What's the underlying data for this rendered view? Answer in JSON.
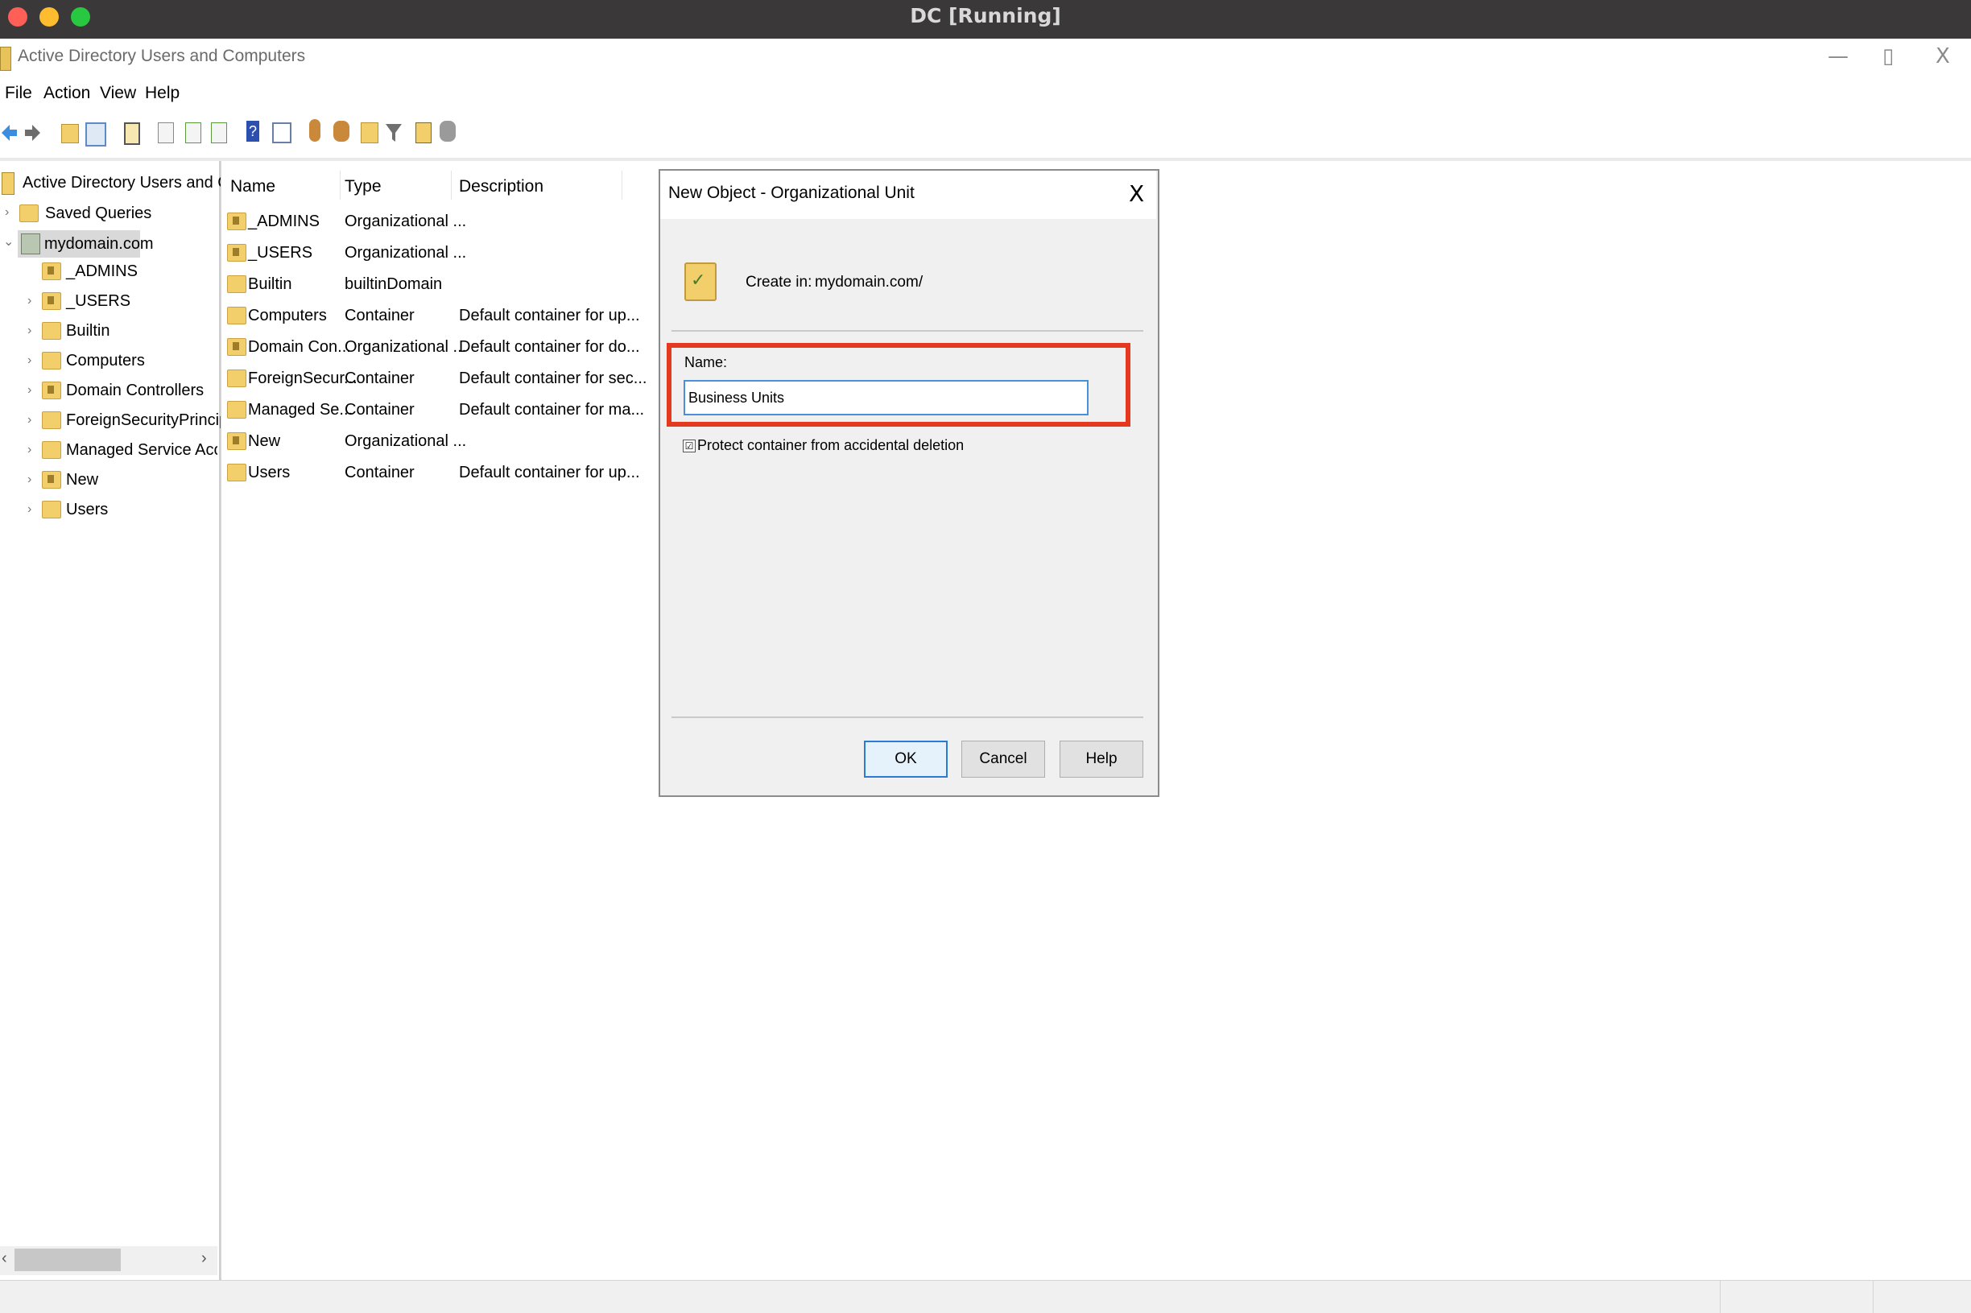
{
  "mac": {
    "title": "DC [Running]",
    "colors": {
      "close": "#fe5f57",
      "minimize": "#febc2e",
      "zoom": "#28c840"
    }
  },
  "window": {
    "title": "Active Directory Users and Computers",
    "minimize": "—",
    "restore": "▯",
    "close": "X"
  },
  "menu": {
    "items": [
      "File",
      "Action",
      "View",
      "Help"
    ]
  },
  "toolbar": {
    "icons": [
      "back-icon",
      "forward-icon",
      "up-folder-icon",
      "show-hide-console-tree-icon",
      "clipboard-icon",
      "properties-icon",
      "refresh-icon",
      "export-list-icon",
      "help-icon",
      "console-view-icon",
      "new-user-icon",
      "new-group-icon",
      "new-ou-icon",
      "filter-icon",
      "find-icon",
      "delegate-control-icon"
    ]
  },
  "tree": {
    "root": "Active Directory Users and Comp",
    "saved_queries": "Saved Queries",
    "domain": "mydomain.com",
    "children": [
      {
        "label": "_ADMINS",
        "chevron": ""
      },
      {
        "label": "_USERS",
        "chevron": "›"
      },
      {
        "label": "Builtin",
        "chevron": "›"
      },
      {
        "label": "Computers",
        "chevron": "›"
      },
      {
        "label": "Domain Controllers",
        "chevron": "›"
      },
      {
        "label": "ForeignSecurityPrincipals",
        "chevron": "›"
      },
      {
        "label": "Managed Service Accoun",
        "chevron": "›"
      },
      {
        "label": "New",
        "chevron": "›"
      },
      {
        "label": "Users",
        "chevron": "›"
      }
    ],
    "scroll_left": "‹",
    "scroll_right": "›"
  },
  "list": {
    "columns": {
      "name": "Name",
      "type": "Type",
      "description": "Description"
    },
    "rows": [
      {
        "name": "_ADMINS",
        "type": "Organizational ...",
        "description": ""
      },
      {
        "name": "_USERS",
        "type": "Organizational ...",
        "description": ""
      },
      {
        "name": "Builtin",
        "type": "builtinDomain",
        "description": ""
      },
      {
        "name": "Computers",
        "type": "Container",
        "description": "Default container for up..."
      },
      {
        "name": "Domain Con...",
        "type": "Organizational ...",
        "description": "Default container for do..."
      },
      {
        "name": "ForeignSecur...",
        "type": "Container",
        "description": "Default container for sec..."
      },
      {
        "name": "Managed Se...",
        "type": "Container",
        "description": "Default container for ma..."
      },
      {
        "name": "New",
        "type": "Organizational ...",
        "description": ""
      },
      {
        "name": "Users",
        "type": "Container",
        "description": "Default container for up..."
      }
    ]
  },
  "dialog": {
    "title": "New Object - Organizational Unit",
    "close": "X",
    "create_in_label": "Create in:",
    "create_in_value": "mydomain.com/",
    "name_label": "Name:",
    "name_value": "Business Units",
    "protect_label": "Protect container from accidental deletion",
    "protect_checked": "☑",
    "ok": "OK",
    "cancel": "Cancel",
    "help": "Help",
    "highlight_color": "#e5391f"
  }
}
